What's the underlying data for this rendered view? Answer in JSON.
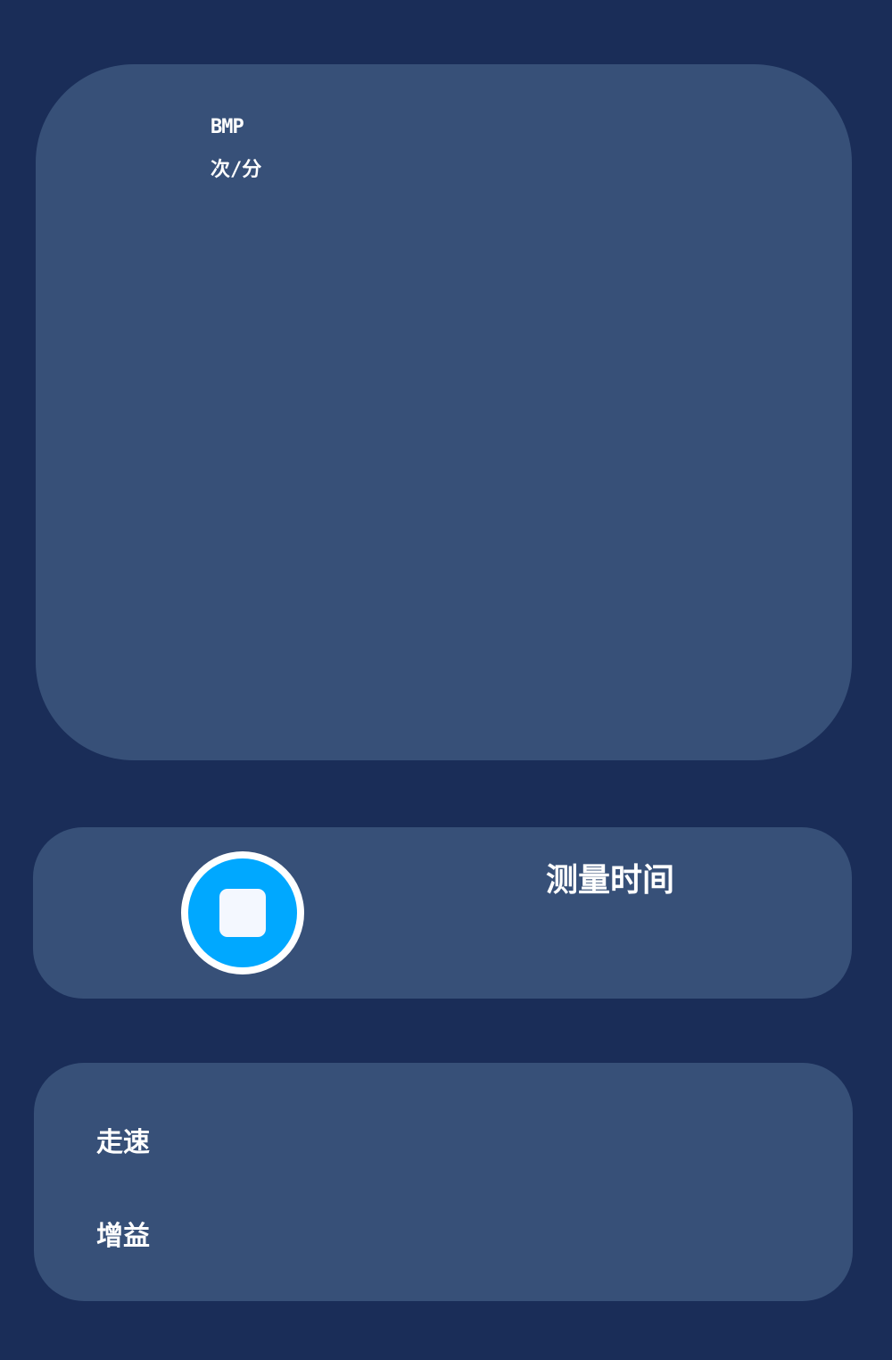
{
  "monitor": {
    "bpm_label": "BMP",
    "bpm_unit": "次/分"
  },
  "controls": {
    "stop_button_icon": "stop-icon",
    "measure_time_label": "测量时间"
  },
  "settings": {
    "items": [
      {
        "label": "走速"
      },
      {
        "label": "增益"
      }
    ]
  },
  "colors": {
    "background": "#1a2d58",
    "card": "#375078",
    "accent": "#00a8ff",
    "text": "#ffffff"
  }
}
